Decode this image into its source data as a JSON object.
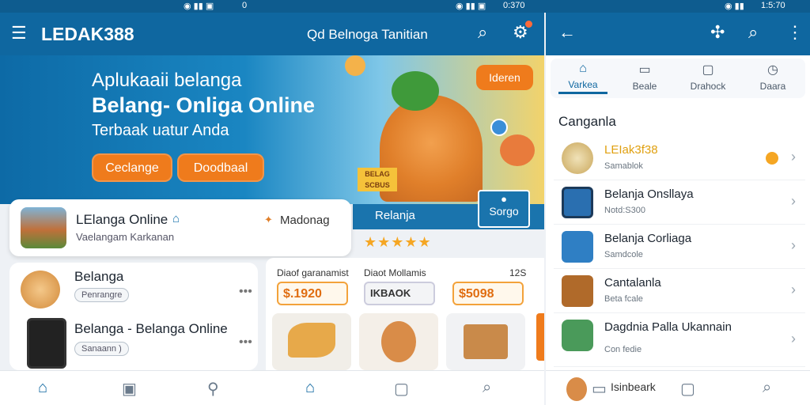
{
  "status": {
    "left_time": "0",
    "mid_time": "0:370",
    "right_time": "1:5:70"
  },
  "left_screen": {
    "brand": "LEDAK388",
    "banner": {
      "line1": "Aplukaaii belanga",
      "line2": "Belang- Onliga Online",
      "line3": "Terbaak uatur Anda",
      "btn1": "Ceclange",
      "btn2": "Doodbaal"
    },
    "card": {
      "title": "LElanga Online",
      "subtitle": "Vaelangam Karkanan",
      "meta": "Madonag"
    },
    "list": [
      {
        "title": "Belanga",
        "chip": "Penrangre"
      },
      {
        "title": "Belanga - Belanga Online",
        "chip": "Sanaann )"
      }
    ]
  },
  "mid_screen": {
    "title": "Qd Belnoga Tanitian",
    "bubble": "Ideren",
    "tag": "BELAG SCBUS",
    "tab_label": "Relanja",
    "sorgo": "Sorgo",
    "stars": "★★★★★",
    "products": [
      {
        "label": "Diaof garanamist",
        "price": "$.1920"
      },
      {
        "label": "Diaot Mollamis",
        "price": "IKBAOK"
      },
      {
        "label": "12S",
        "price": "$5098"
      }
    ]
  },
  "right_screen": {
    "tabs": [
      "Varkea",
      "Beale",
      "Drahock",
      "Daara"
    ],
    "section": "Canganla",
    "rows": [
      {
        "title": "LEIak3f38",
        "sub": "Samablok"
      },
      {
        "title": "Belanja Onsllaya",
        "sub": "Notd:S300"
      },
      {
        "title": "Belanja Corliaga",
        "sub": "Samdcole"
      },
      {
        "title": "Cantalanla",
        "sub": "Beta fcale"
      },
      {
        "title": "Dagdnia Palla Ukannain",
        "sub": "Con fedie"
      }
    ],
    "nav_label": "Isinbeark"
  },
  "colors": {
    "primary": "#0f67a0",
    "accent": "#ef7b1c"
  }
}
